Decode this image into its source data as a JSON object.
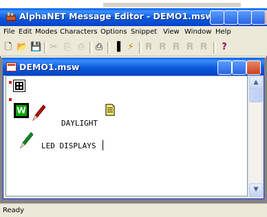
{
  "app": {
    "title": "AlphaNET Message Editor - DEMO1.msw"
  },
  "menu": [
    "File",
    "Edit",
    "Modes",
    "Characters",
    "Options",
    "Snippet",
    "View",
    "Window",
    "Help"
  ],
  "toolbar": [
    "new",
    "open",
    "save",
    "cut",
    "copy",
    "paste",
    "print",
    "set-position",
    "flash",
    "snippet-1",
    "snippet-2",
    "snippet-3",
    "snippet-4",
    "snippet-5",
    "help"
  ],
  "document": {
    "title": "DEMO1.msw",
    "line1": "DAYLIGHT",
    "line2": "LED DISPLAYS"
  },
  "status": "Ready",
  "colors": {
    "titlebar": "#0b5bdc",
    "chrome": "#ece9d8",
    "mdi_background": "#848284"
  }
}
